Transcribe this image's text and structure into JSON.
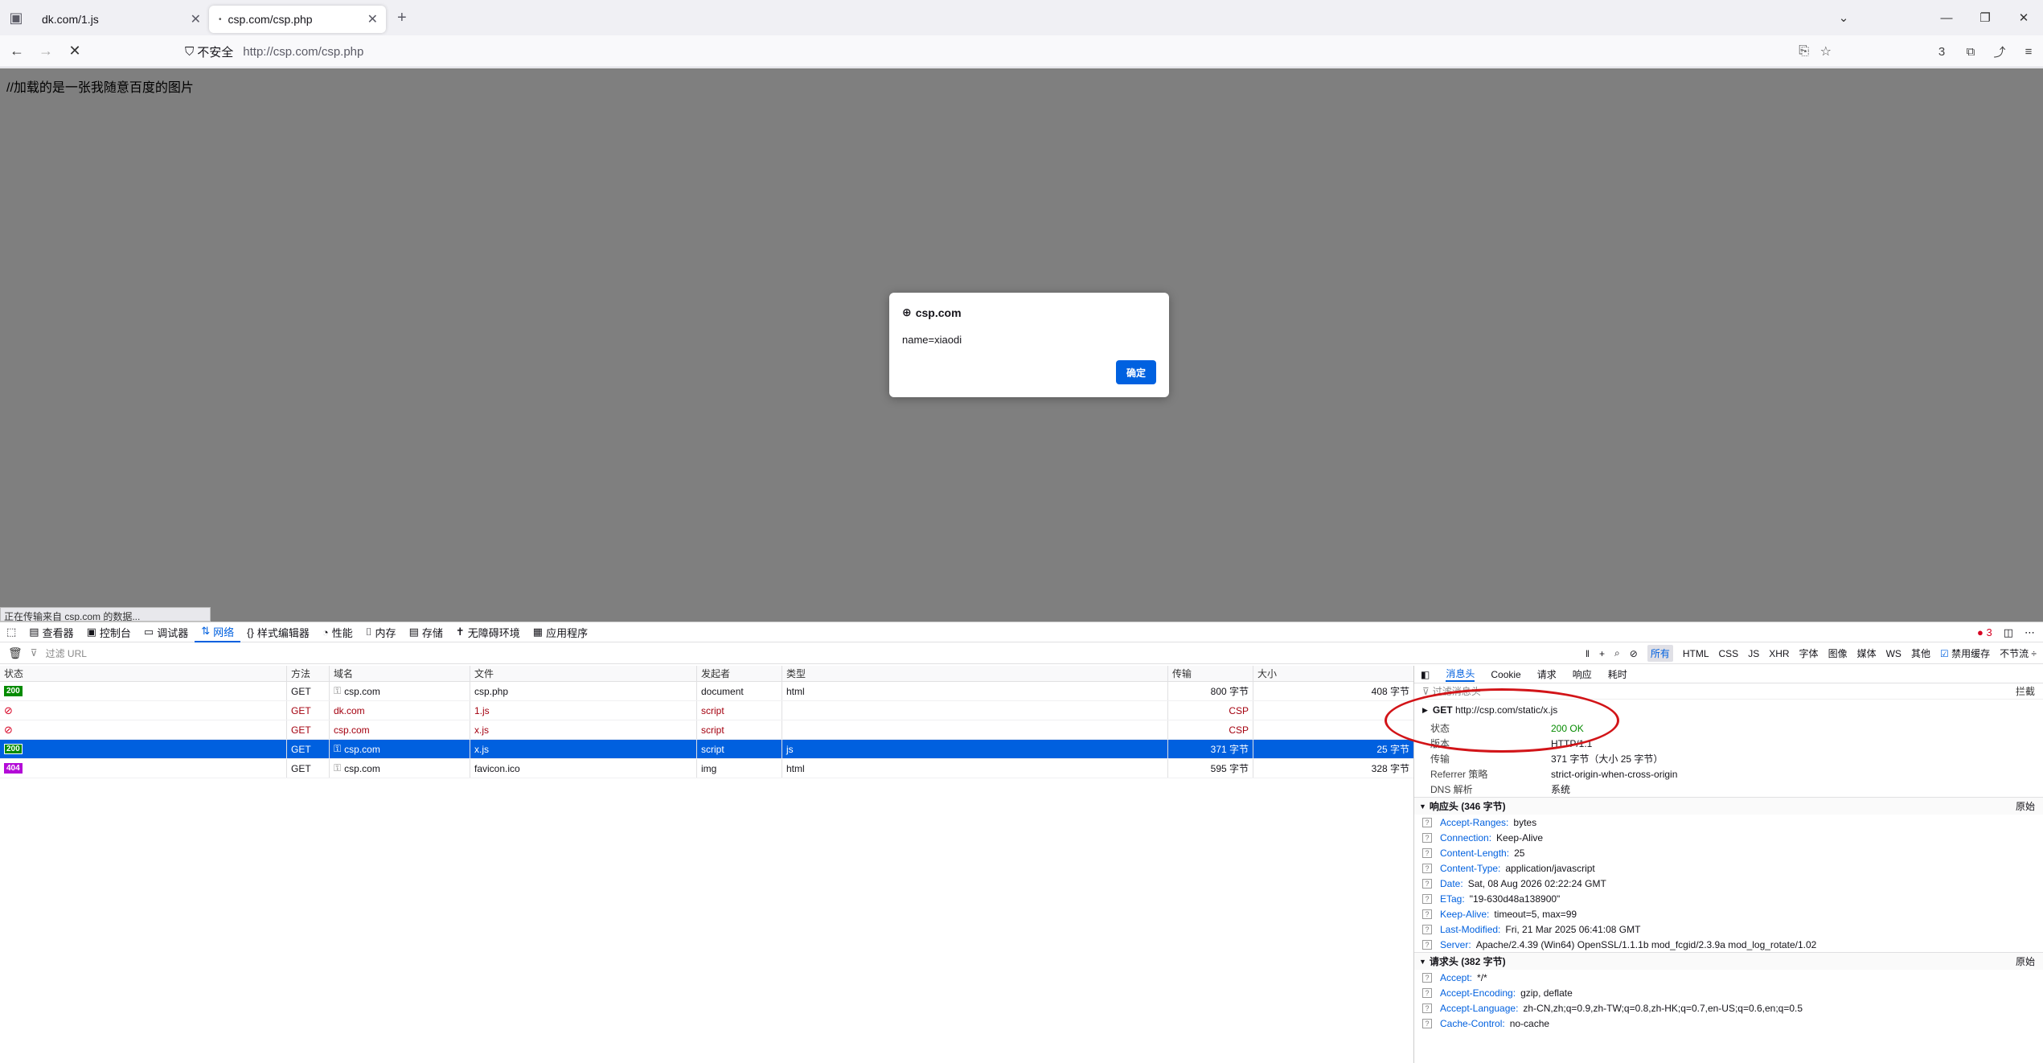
{
  "tabs": [
    {
      "label": "dk.com/1.js"
    },
    {
      "label": "csp.com/csp.php"
    }
  ],
  "address": {
    "security_label": "不安全",
    "url": "http://csp.com/csp.php",
    "ext_badge": "3"
  },
  "page": {
    "text": "//加载的是一张我随意百度的图片",
    "status_text": "正在传输来自 csp.com 的数据..."
  },
  "dialog": {
    "origin": "csp.com",
    "message": "name=xiaodi",
    "ok_label": "确定"
  },
  "devtools": {
    "tools": [
      "查看器",
      "控制台",
      "调试器",
      "网络",
      "样式编辑器",
      "性能",
      "内存",
      "存储",
      "无障碍环境",
      "应用程序"
    ],
    "error_count": "3",
    "filter_placeholder": "过滤 URL",
    "filter_types": [
      "所有",
      "HTML",
      "CSS",
      "JS",
      "XHR",
      "字体",
      "图像",
      "媒体",
      "WS",
      "其他"
    ],
    "disable_cache": "禁用缓存",
    "throttle": "不节流 ÷"
  },
  "table": {
    "headers": [
      "状态",
      "方法",
      "域名",
      "文件",
      "发起者",
      "类型",
      "传输",
      "大小"
    ],
    "rows": [
      {
        "status": "200",
        "method": "GET",
        "domain": "csp.com",
        "file": "csp.php",
        "initiator": "document",
        "type": "html",
        "transfer": "800 字节",
        "size": "408 字节"
      },
      {
        "status": "",
        "method": "GET",
        "domain": "dk.com",
        "file": "1.js",
        "initiator": "script",
        "type": "",
        "transfer": "CSP",
        "size": ""
      },
      {
        "status": "",
        "method": "GET",
        "domain": "csp.com",
        "file": "x.js",
        "initiator": "script",
        "type": "",
        "transfer": "CSP",
        "size": ""
      },
      {
        "status": "200",
        "method": "GET",
        "domain": "csp.com",
        "file": "x.js",
        "initiator": "script",
        "type": "js",
        "transfer": "371 字节",
        "size": "25 字节"
      },
      {
        "status": "404",
        "method": "GET",
        "domain": "csp.com",
        "file": "favicon.ico",
        "initiator": "img",
        "type": "html",
        "transfer": "595 字节",
        "size": "328 字节"
      }
    ]
  },
  "details": {
    "tabs": [
      "消息头",
      "Cookie",
      "请求",
      "响应",
      "耗时"
    ],
    "filter": "过滤消息头",
    "block_label": "拦截",
    "request": {
      "method": "GET",
      "url": "http://csp.com/static/x.js"
    },
    "summary": [
      {
        "k": "状态",
        "v": "200 OK"
      },
      {
        "k": "版本",
        "v": "HTTP/1.1"
      },
      {
        "k": "传输",
        "v": "371 字节（大小 25 字节）"
      },
      {
        "k": "Referrer 策略",
        "v": "strict-origin-when-cross-origin"
      },
      {
        "k": "DNS 解析",
        "v": "系统"
      }
    ],
    "response_title": "响应头 (346 字节)",
    "raw_label": "原始",
    "response_headers": [
      {
        "k": "Accept-Ranges:",
        "v": "bytes"
      },
      {
        "k": "Connection:",
        "v": "Keep-Alive"
      },
      {
        "k": "Content-Length:",
        "v": "25"
      },
      {
        "k": "Content-Type:",
        "v": "application/javascript"
      },
      {
        "k": "Date:",
        "v": "Sat, 08 Aug 2026 02:22:24 GMT"
      },
      {
        "k": "ETag:",
        "v": "\"19-630d48a138900\""
      },
      {
        "k": "Keep-Alive:",
        "v": "timeout=5, max=99"
      },
      {
        "k": "Last-Modified:",
        "v": "Fri, 21 Mar 2025 06:41:08 GMT"
      },
      {
        "k": "Server:",
        "v": "Apache/2.4.39 (Win64) OpenSSL/1.1.1b mod_fcgid/2.3.9a mod_log_rotate/1.02"
      }
    ],
    "request_title": "请求头 (382 字节)",
    "request_headers": [
      {
        "k": "Accept:",
        "v": "*/*"
      },
      {
        "k": "Accept-Encoding:",
        "v": "gzip, deflate"
      },
      {
        "k": "Accept-Language:",
        "v": "zh-CN,zh;q=0.9,zh-TW;q=0.8,zh-HK;q=0.7,en-US;q=0.6,en;q=0.5"
      },
      {
        "k": "Cache-Control:",
        "v": "no-cache"
      }
    ]
  },
  "colors": {
    "accent": "#0060df",
    "annotation": "#d21418",
    "ok": "#058b00"
  }
}
